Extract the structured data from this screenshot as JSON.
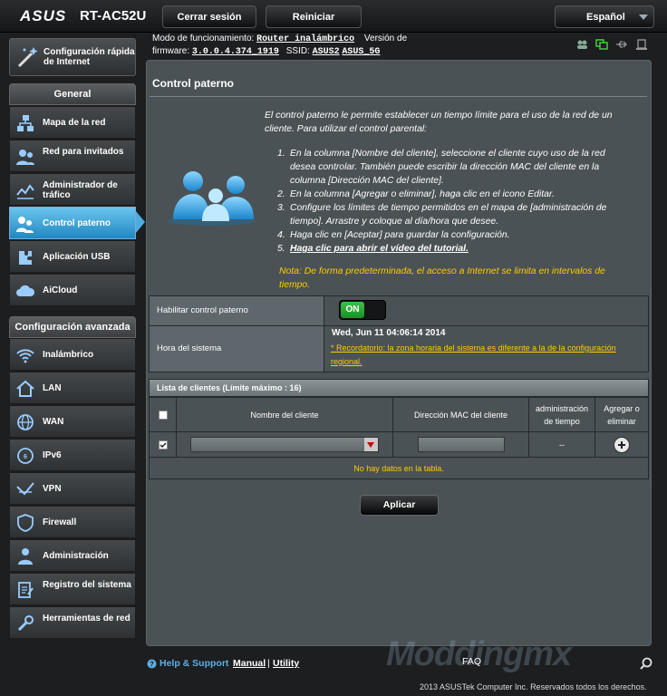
{
  "header": {
    "brand": "ASUS",
    "model": "RT-AC52U",
    "logout_label": "Cerrar sesión",
    "reboot_label": "Reiniciar",
    "language": "Español"
  },
  "status": {
    "mode_label": "Modo de funcionamiento:",
    "mode_value": "Router inalámbrico",
    "version_label": "Versión de",
    "firmware_label": "firmware:",
    "firmware_value": "3.0.0.4.374_1919",
    "ssid_label": "SSID:",
    "ssid_1": "ASUS2",
    "ssid_2": "ASUS_5G"
  },
  "sidebar": {
    "quick_setup": "Configuración rápida de Internet",
    "general_title": "General",
    "general_items": [
      {
        "label": "Mapa de la red",
        "icon": "network-map-icon"
      },
      {
        "label": "Red para invitados",
        "icon": "guest-network-icon"
      },
      {
        "label": "Administrador de tráfico",
        "icon": "traffic-manager-icon"
      },
      {
        "label": "Control paterno",
        "icon": "parental-control-icon",
        "active": true
      },
      {
        "label": "Aplicación USB",
        "icon": "usb-app-icon"
      },
      {
        "label": "AiCloud",
        "icon": "aicloud-icon"
      }
    ],
    "advanced_title": "Configuración avanzada",
    "advanced_items": [
      {
        "label": "Inalámbrico",
        "icon": "wireless-icon"
      },
      {
        "label": "LAN",
        "icon": "lan-icon"
      },
      {
        "label": "WAN",
        "icon": "wan-icon"
      },
      {
        "label": "IPv6",
        "icon": "ipv6-icon"
      },
      {
        "label": "VPN",
        "icon": "vpn-icon"
      },
      {
        "label": "Firewall",
        "icon": "firewall-icon"
      },
      {
        "label": "Administración",
        "icon": "administration-icon"
      },
      {
        "label": "Registro del sistema",
        "icon": "system-log-icon"
      },
      {
        "label": "Herramientas de red",
        "icon": "network-tools-icon"
      }
    ]
  },
  "main": {
    "title": "Control paterno",
    "intro": "El control paterno le permite establecer un tiempo límite para el uso de la red de un cliente. Para utilizar el control parental:",
    "steps": [
      "En la columna [Nombre del cliente], seleccione el cliente cuyo uso de la red desea controlar. También puede escribir la dirección MAC del cliente en la columna [Dirección MAC del cliente].",
      "En la columna [Agregar o eliminar], haga clic en el icono Editar.",
      "Configure los límites de tiempo permitidos en el mapa de [administración de tiempo]. Arrastre y coloque al día/hora que desee.",
      "Haga clic en [Aceptar] para guardar la configuración.",
      "Haga clic para abrir el vídeo del tutorial."
    ],
    "note": "Nota: De forma predeterminada, el acceso a Internet se limita en intervalos de tiempo.",
    "enable_label": "Habilitar control paterno",
    "toggle_state": "ON",
    "time_label": "Hora del sistema",
    "time_value": "Wed, Jun 11 04:06:14 2014",
    "reminder": "* Recordatorio: la zona horaria del sistema es diferente a la de la configuración regional.",
    "client_list_title": "Lista de clientes (Límite máximo : 16)",
    "columns": {
      "name": "Nombre del cliente",
      "mac": "Dirección MAC del cliente",
      "time_mgmt": "administración de tiempo",
      "add_remove": "Agregar o eliminar"
    },
    "time_placeholder": "--",
    "no_data": "No hay datos en la tabla.",
    "apply_label": "Aplicar"
  },
  "footer": {
    "help": "Help & Support",
    "manual": "Manual",
    "separator": "|",
    "utility": "Utility",
    "faq": "FAQ",
    "copyright": "2013 ASUSTek Computer Inc. Reservados todos los derechos.",
    "watermark": "Moddingmx"
  },
  "colors": {
    "accent": "#4cadde",
    "toggle_on": "#2aa836",
    "warning": "#ffcc00",
    "panel": "#4a5256"
  }
}
